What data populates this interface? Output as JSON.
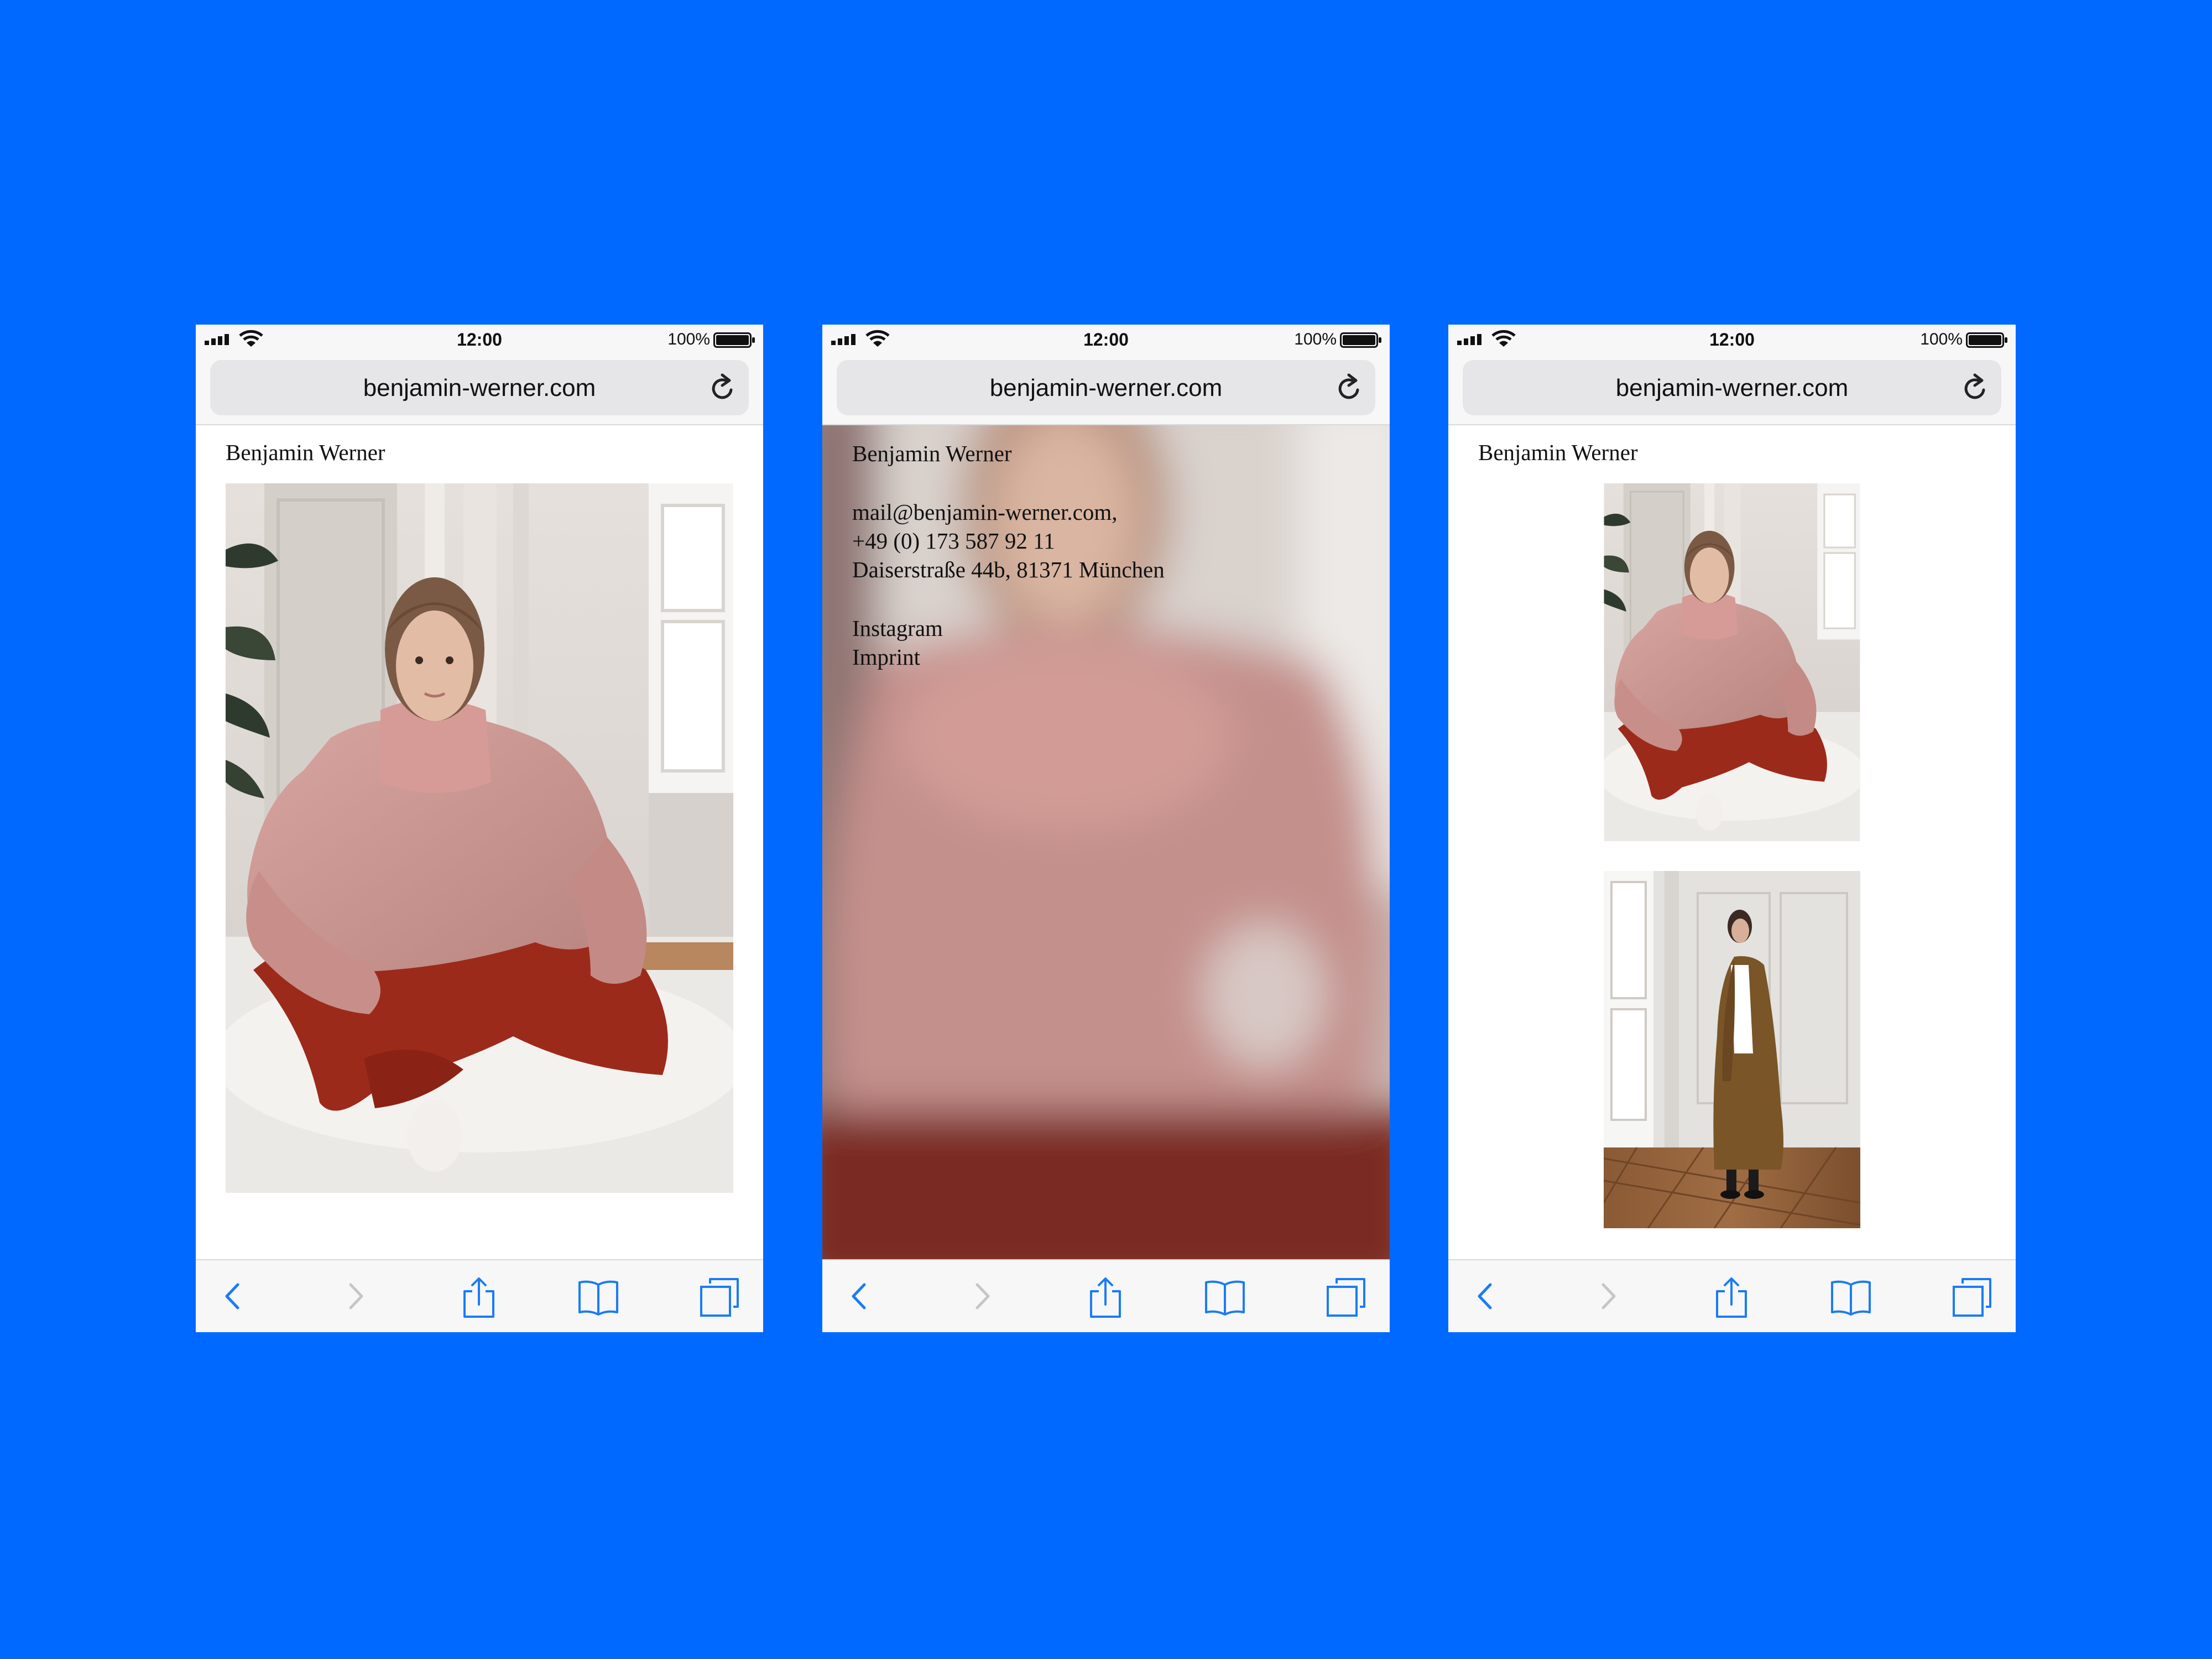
{
  "status": {
    "time": "12:00",
    "battery": "100%"
  },
  "browser": {
    "url": "benjamin-werner.com"
  },
  "site": {
    "title": "Benjamin Werner",
    "contact": {
      "email": "mail@benjamin-werner.com,",
      "phone": "+49 (0) 173 587 92 11",
      "address": "Daiserstraße 44b, 81371 München"
    },
    "links": {
      "instagram": "Instagram",
      "imprint": "Imprint"
    }
  },
  "icons": {
    "back": "chevron-left-icon",
    "forward": "chevron-right-icon",
    "share": "share-icon",
    "bookmarks": "book-icon",
    "tabs": "tabs-icon",
    "reload": "reload-icon"
  },
  "colors": {
    "background": "#0069ff",
    "browser_chrome": "#f7f7f7",
    "ios_accent": "#1a7cf5",
    "text": "#111111"
  }
}
